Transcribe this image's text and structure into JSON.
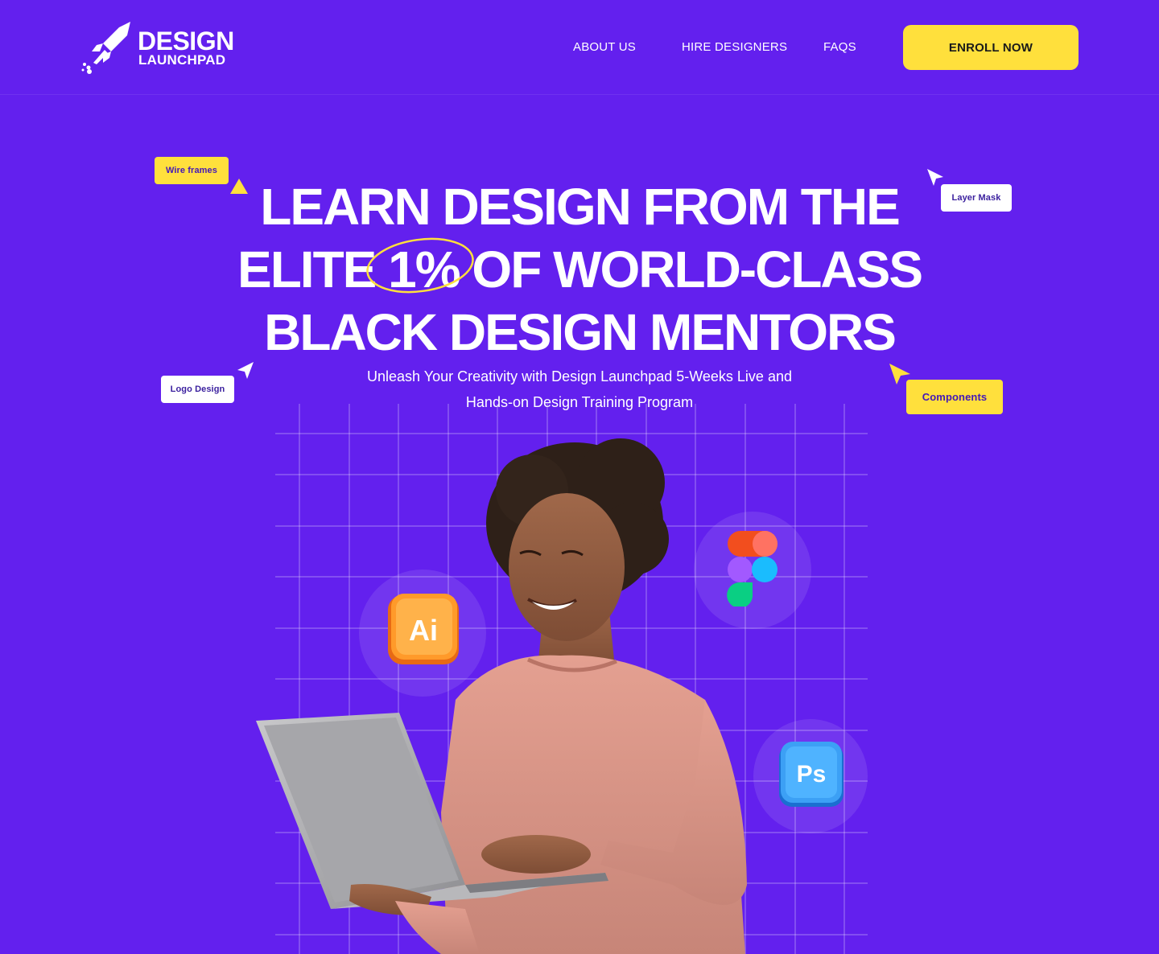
{
  "brand": {
    "name_line1": "DESIGN",
    "name_line2": "LAUNCHPAD"
  },
  "nav": {
    "links": [
      "ABOUT US",
      "HIRE DESIGNERS",
      "FAQS"
    ],
    "cta": "ENROLL NOW"
  },
  "hero": {
    "headline_line1": "LEARN DESIGN FROM THE",
    "headline_line2_pre": "ELITE ",
    "headline_highlight": "1%",
    "headline_line2_post": " OF WORLD-CLASS",
    "headline_line3": "BLACK DESIGN MENTORS",
    "subtitle_line1": "Unleash Your Creativity with Design Launchpad 5-Weeks Live and",
    "subtitle_line2": "Hands-on Design Training Program"
  },
  "tags": {
    "wireframes": "Wire frames",
    "layer_mask": "Layer Mask",
    "logo_design": "Logo Design",
    "components": "Components"
  },
  "app_icons": {
    "illustrator": "Ai",
    "photoshop": "Ps",
    "figma": "figma-icon"
  },
  "colors": {
    "background": "#6320EE",
    "accent_yellow": "#FFE03C",
    "text": "#FFFFFF"
  }
}
